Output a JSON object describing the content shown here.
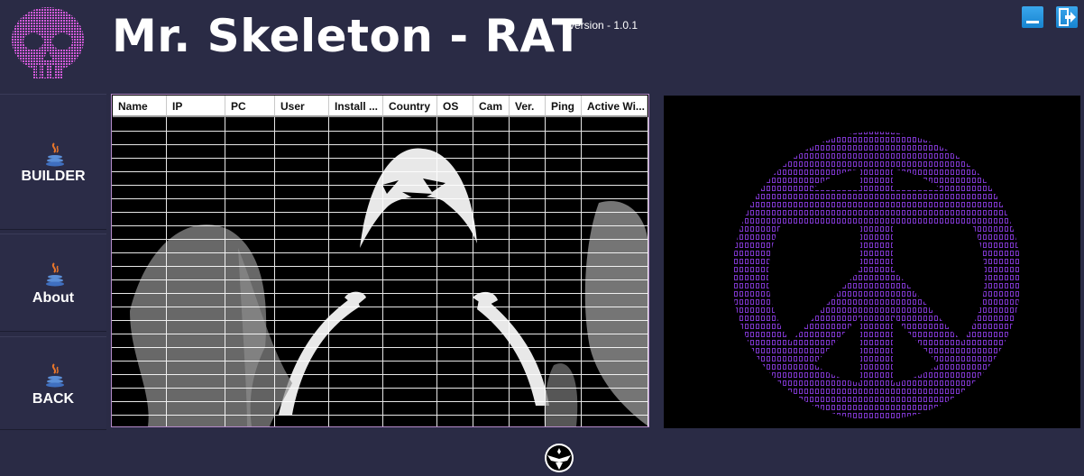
{
  "app": {
    "title": "Mr. Skeleton - RAT",
    "version": "version - 1.0.1"
  },
  "window_controls": [
    {
      "name": "minimize",
      "icon": "minimize-icon"
    },
    {
      "name": "exit",
      "icon": "exit-icon"
    }
  ],
  "sidebar": {
    "items": [
      {
        "label": "BUILDER",
        "icon": "java-icon"
      },
      {
        "label": "About",
        "icon": "java-icon"
      },
      {
        "label": "BACK",
        "icon": "java-icon"
      }
    ]
  },
  "clients_table": {
    "columns": [
      "Name",
      "IP",
      "PC",
      "User",
      "Install ...",
      "Country",
      "OS",
      "Cam",
      "Ver.",
      "Ping",
      "Active Wi..."
    ],
    "rows": []
  },
  "colors": {
    "background": "#2a2b45",
    "accent_purple": "#b48ac9",
    "ascii_purple": "#8a3fd6",
    "logo_pink": "#d05ad8",
    "button_blue": "#1e8fdb"
  },
  "icons": {
    "logo": "skull-logo-icon",
    "footer": "eagle-emblem-icon",
    "table_background": "hooded-figure-image",
    "side_panel": "ascii-peace-sign-image"
  }
}
